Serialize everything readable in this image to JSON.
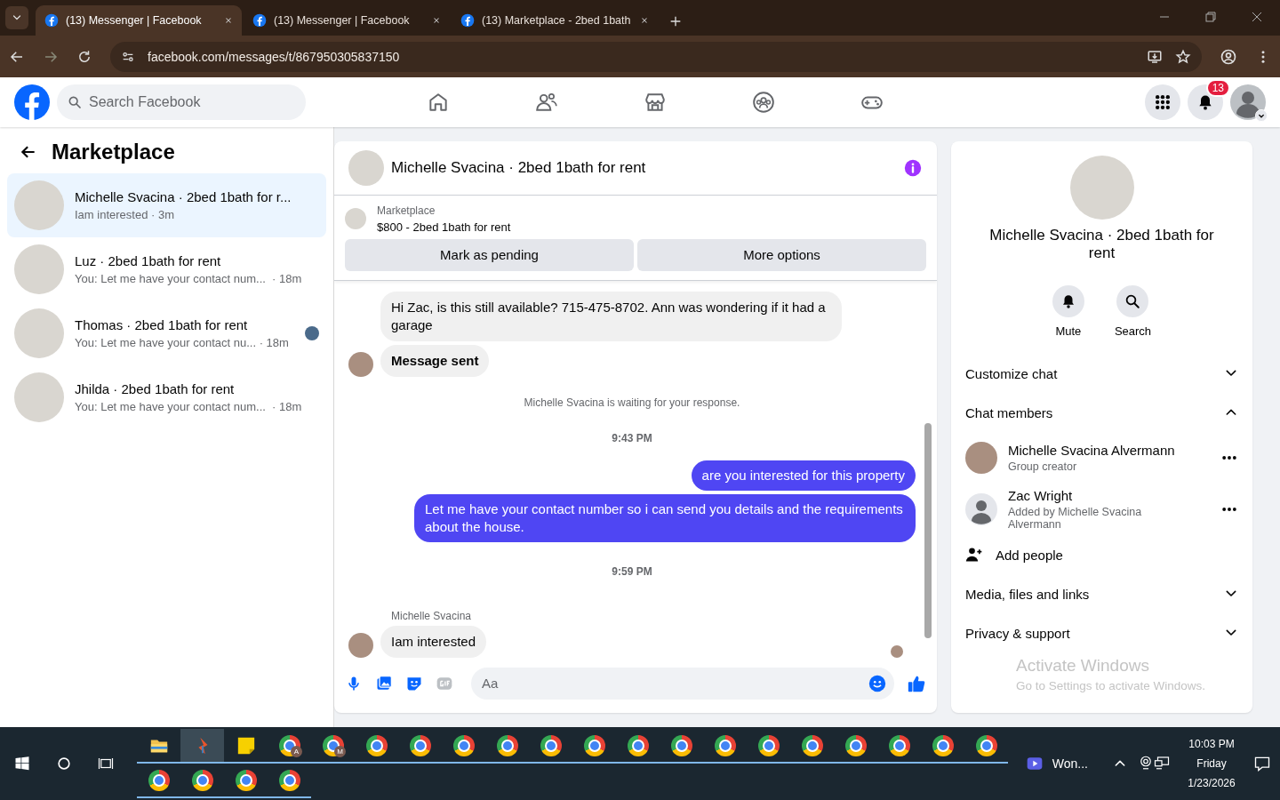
{
  "browser": {
    "tabs": [
      {
        "title": "(13) Messenger | Facebook",
        "selected": true
      },
      {
        "title": "(13) Messenger | Facebook",
        "selected": false
      },
      {
        "title": "(13) Marketplace - 2bed 1bath",
        "selected": false
      }
    ],
    "url": "facebook.com/messages/t/867950305837150"
  },
  "header": {
    "search_placeholder": "Search Facebook",
    "notification_count": "13"
  },
  "sidebar": {
    "title": "Marketplace",
    "conversations": [
      {
        "name": "Michelle Svacina · 2bed 1bath for r...",
        "preview": "Iam interested · 3m",
        "selected": true,
        "seen_avatar": false
      },
      {
        "name": "Luz · 2bed 1bath for rent",
        "preview": "You: Let me have your contact num...  · 18m",
        "selected": false,
        "seen_avatar": false
      },
      {
        "name": "Thomas · 2bed 1bath for rent",
        "preview": "You: Let me have your contact nu... · 18m",
        "selected": false,
        "seen_avatar": true
      },
      {
        "name": "Jhilda · 2bed 1bath for rent",
        "preview": "You: Let me have your contact num...  · 18m",
        "selected": false,
        "seen_avatar": false
      }
    ]
  },
  "chat": {
    "title": "Michelle Svacina · 2bed 1bath for rent",
    "listing": {
      "label": "Marketplace",
      "title": "$800 - 2bed 1bath for rent"
    },
    "buttons": [
      "Mark as pending",
      "More options"
    ],
    "messages": [
      {
        "kind": "incoming",
        "text": "Hi Zac, is this still available? 715-475-8702. Ann was wondering if it had a garage",
        "avatar": false,
        "bold": false
      },
      {
        "kind": "incoming",
        "text": "Message sent",
        "avatar": true,
        "bold": true
      },
      {
        "kind": "notice",
        "text": "Michelle Svacina is waiting for your response."
      },
      {
        "kind": "time",
        "text": "9:43 PM"
      },
      {
        "kind": "outgoing",
        "text": "are you interested for this property"
      },
      {
        "kind": "outgoing",
        "text": "Let me have your contact number so i can send you details and the requirements about the house."
      },
      {
        "kind": "time",
        "text": "9:59 PM"
      },
      {
        "kind": "sender",
        "text": "Michelle Svacina"
      },
      {
        "kind": "incoming",
        "text": "Iam interested",
        "avatar": true,
        "bold": false
      }
    ],
    "seen_receipt": true,
    "composer_placeholder": "Aa"
  },
  "info": {
    "title": "Michelle Svacina · 2bed 1bath for rent",
    "actions": [
      {
        "kind": "mute",
        "label": "Mute"
      },
      {
        "kind": "search",
        "label": "Search"
      }
    ],
    "sections": [
      {
        "label": "Customize chat",
        "expanded": false
      },
      {
        "label": "Chat members",
        "expanded": true,
        "members": [
          {
            "name": "Michelle Svacina Alvermann",
            "role": "Group creator",
            "photo": true
          },
          {
            "name": "Zac Wright",
            "role": "Added by Michelle Svacina Alvermann",
            "photo": false
          }
        ],
        "add_label": "Add people"
      },
      {
        "label": "Media, files and links",
        "expanded": false
      },
      {
        "label": "Privacy & support",
        "expanded": false
      }
    ],
    "watermark": {
      "title": "Activate Windows",
      "subtitle": "Go to Settings to activate Windows."
    }
  },
  "taskbar": {
    "apps": [
      {
        "kind": "folder",
        "active": false
      },
      {
        "kind": "app",
        "active": true
      },
      {
        "kind": "notes",
        "active": false
      },
      {
        "kind": "chrome",
        "badge": "A",
        "active": false
      },
      {
        "kind": "chrome",
        "badge": "M",
        "active": false
      },
      {
        "kind": "chrome",
        "active": false
      },
      {
        "kind": "chrome",
        "active": false
      },
      {
        "kind": "chrome",
        "active": false
      },
      {
        "kind": "chrome",
        "active": false
      },
      {
        "kind": "chrome",
        "active": false
      },
      {
        "kind": "chrome",
        "active": false
      },
      {
        "kind": "chrome",
        "active": false
      },
      {
        "kind": "chrome",
        "active": false
      },
      {
        "kind": "chrome",
        "active": false
      },
      {
        "kind": "chrome",
        "active": false
      },
      {
        "kind": "chrome",
        "active": false
      },
      {
        "kind": "chrome",
        "active": false
      },
      {
        "kind": "chrome",
        "active": false
      },
      {
        "kind": "chrome",
        "active": false
      },
      {
        "kind": "chrome",
        "active": false
      },
      {
        "kind": "chrome",
        "active": false
      },
      {
        "kind": "chrome",
        "active": false
      },
      {
        "kind": "chrome",
        "active": false
      },
      {
        "kind": "chrome",
        "active": false
      }
    ],
    "running": "Won...",
    "time": "10:03 PM",
    "day": "Friday",
    "date": "1/23/2026"
  }
}
